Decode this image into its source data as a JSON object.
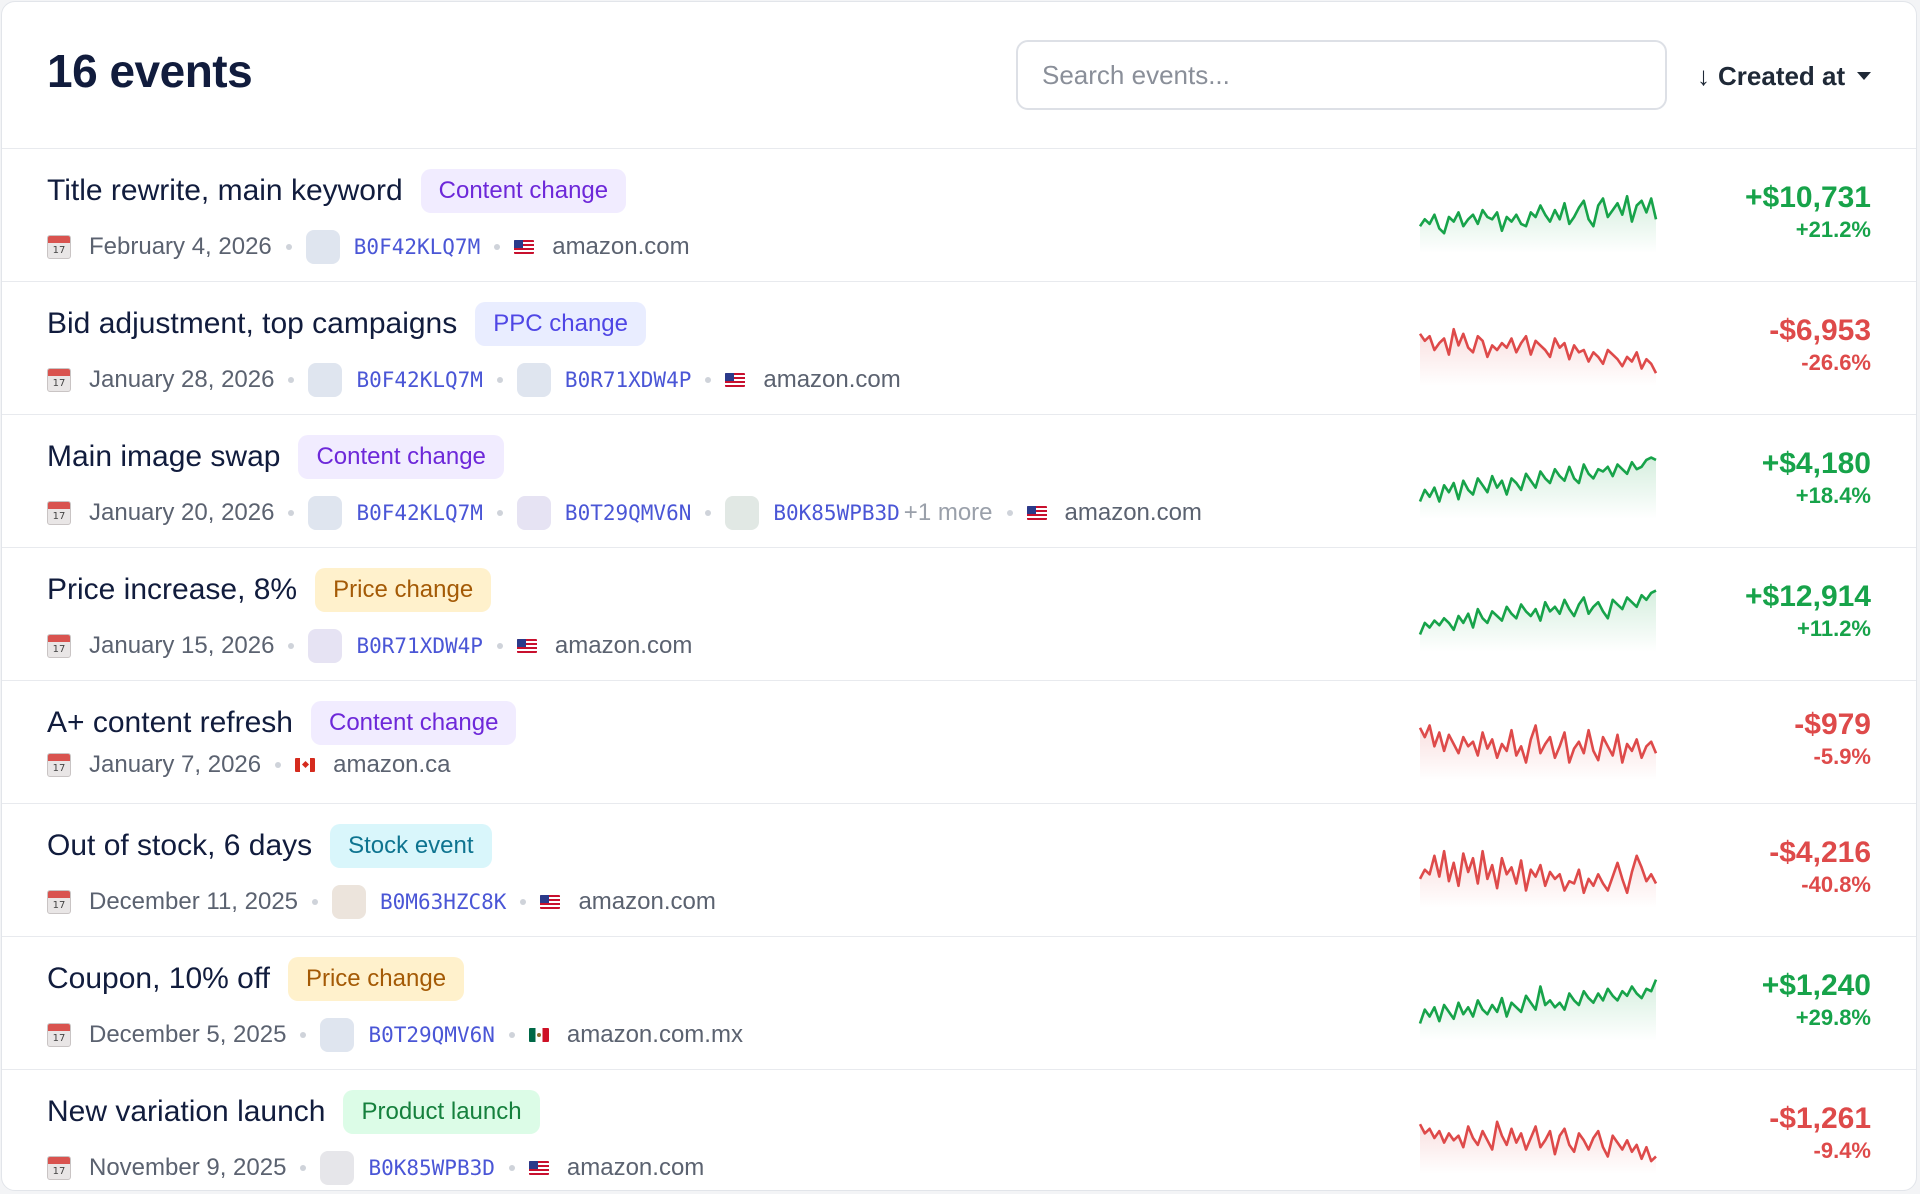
{
  "header": {
    "title": "16 events",
    "search_placeholder": "Search events...",
    "sort_label": "Created at",
    "sort_arrow": "↓"
  },
  "colors": {
    "positive": "#17a34a",
    "negative": "#de4a4a",
    "asin": "#4a56d6"
  },
  "events": [
    {
      "name": "Title rewrite, main keyword",
      "tag": "Content change",
      "tag_type": "content",
      "date": "February 4, 2026",
      "asins": [
        {
          "code": "B0F42KLQ7M",
          "thumb": "#dfe5ef"
        }
      ],
      "more": "",
      "flag": "us",
      "marketplace": "amazon.com",
      "amount": "+$10,731",
      "percent": "+21.2%",
      "trend": "positive",
      "spark": [
        38,
        44,
        40,
        48,
        36,
        32,
        46,
        42,
        50,
        38,
        44,
        48,
        40,
        52,
        46,
        44,
        50,
        34,
        46,
        42,
        48,
        40,
        38,
        50,
        46,
        56,
        48,
        42,
        52,
        44,
        58,
        40,
        46,
        54,
        60,
        44,
        38,
        56,
        62,
        46,
        52,
        58,
        48,
        64,
        42,
        56,
        60,
        50,
        62,
        44
      ]
    },
    {
      "name": "Bid adjustment, top campaigns",
      "tag": "PPC change",
      "tag_type": "ppc",
      "date": "January 28, 2026",
      "asins": [
        {
          "code": "B0F42KLQ7M",
          "thumb": "#dfe5ef"
        },
        {
          "code": "B0R71XDW4P",
          "thumb": "#dfe5ef"
        }
      ],
      "more": "",
      "flag": "us",
      "marketplace": "amazon.com",
      "amount": "-$6,953",
      "percent": "-26.6%",
      "trend": "negative",
      "spark": [
        60,
        54,
        58,
        46,
        52,
        56,
        42,
        64,
        50,
        60,
        48,
        44,
        58,
        54,
        40,
        50,
        46,
        52,
        48,
        56,
        44,
        52,
        58,
        42,
        54,
        50,
        46,
        40,
        56,
        48,
        52,
        38,
        50,
        44,
        46,
        36,
        44,
        40,
        34,
        46,
        42,
        38,
        32,
        40,
        36,
        44,
        30,
        38,
        34,
        26
      ]
    },
    {
      "name": "Main image swap",
      "tag": "Content change",
      "tag_type": "content",
      "date": "January 20, 2026",
      "asins": [
        {
          "code": "B0F42KLQ7M",
          "thumb": "#dfe5ef"
        },
        {
          "code": "B0T29QMV6N",
          "thumb": "#e6e3f3"
        },
        {
          "code": "B0K85WPB3D",
          "thumb": "#e1e8e4"
        }
      ],
      "more": "+1 more",
      "flag": "us",
      "marketplace": "amazon.com",
      "amount": "+$4,180",
      "percent": "+18.4%",
      "trend": "positive",
      "spark": [
        30,
        40,
        34,
        42,
        30,
        44,
        38,
        46,
        32,
        48,
        40,
        36,
        50,
        44,
        38,
        52,
        42,
        48,
        36,
        50,
        46,
        40,
        54,
        48,
        42,
        56,
        50,
        46,
        58,
        52,
        48,
        60,
        50,
        46,
        62,
        54,
        50,
        58,
        56,
        60,
        52,
        62,
        58,
        54,
        64,
        58,
        60,
        66,
        68,
        66
      ]
    },
    {
      "name": "Price increase, 8%",
      "tag": "Price change",
      "tag_type": "price",
      "date": "January 15, 2026",
      "asins": [
        {
          "code": "B0R71XDW4P",
          "thumb": "#e6e3f3"
        }
      ],
      "more": "",
      "flag": "us",
      "marketplace": "amazon.com",
      "amount": "+$12,914",
      "percent": "+11.2%",
      "trend": "positive",
      "spark": [
        30,
        40,
        36,
        42,
        38,
        44,
        40,
        34,
        46,
        40,
        48,
        36,
        52,
        44,
        40,
        50,
        46,
        42,
        54,
        48,
        44,
        56,
        50,
        46,
        52,
        42,
        58,
        50,
        54,
        48,
        60,
        52,
        46,
        56,
        62,
        48,
        54,
        58,
        50,
        44,
        60,
        56,
        52,
        62,
        58,
        54,
        64,
        60,
        66,
        68
      ]
    },
    {
      "name": "A+ content refresh",
      "tag": "Content change",
      "tag_type": "content",
      "date": "January 7, 2026",
      "asins": [],
      "more": "",
      "flag": "ca",
      "marketplace": "amazon.ca",
      "amount": "-$979",
      "percent": "-5.9%",
      "trend": "negative",
      "spark": [
        60,
        52,
        62,
        44,
        56,
        40,
        54,
        46,
        38,
        52,
        44,
        48,
        36,
        56,
        42,
        50,
        34,
        46,
        40,
        58,
        36,
        44,
        30,
        50,
        62,
        38,
        46,
        52,
        34,
        44,
        56,
        30,
        42,
        48,
        38,
        58,
        40,
        32,
        52,
        44,
        36,
        54,
        30,
        46,
        40,
        50,
        34,
        44,
        48,
        38
      ]
    },
    {
      "name": "Out of stock, 6 days",
      "tag": "Stock event",
      "tag_type": "stock",
      "date": "December 11, 2025",
      "asins": [
        {
          "code": "B0M63HZC8K",
          "thumb": "#ece4dc"
        }
      ],
      "more": "",
      "flag": "us",
      "marketplace": "amazon.com",
      "amount": "-$4,216",
      "percent": "-40.8%",
      "trend": "negative",
      "spark": [
        40,
        48,
        44,
        60,
        42,
        64,
        38,
        54,
        34,
        62,
        46,
        58,
        36,
        64,
        40,
        52,
        32,
        58,
        44,
        50,
        36,
        56,
        30,
        48,
        42,
        52,
        34,
        46,
        40,
        44,
        30,
        38,
        36,
        48,
        28,
        40,
        34,
        44,
        36,
        30,
        42,
        54,
        40,
        28,
        46,
        60,
        50,
        38,
        44,
        36
      ]
    },
    {
      "name": "Coupon, 10% off",
      "tag": "Price change",
      "tag_type": "price",
      "date": "December 5, 2025",
      "asins": [
        {
          "code": "B0T29QMV6N",
          "thumb": "#dfe5ef"
        }
      ],
      "more": "",
      "flag": "mx",
      "marketplace": "amazon.com.mx",
      "amount": "+$1,240",
      "percent": "+29.8%",
      "trend": "positive",
      "spark": [
        30,
        42,
        36,
        44,
        32,
        46,
        40,
        34,
        48,
        38,
        44,
        36,
        50,
        42,
        38,
        46,
        40,
        52,
        36,
        48,
        44,
        40,
        54,
        48,
        42,
        62,
        46,
        50,
        44,
        48,
        42,
        56,
        50,
        46,
        58,
        52,
        48,
        56,
        50,
        60,
        54,
        50,
        58,
        54,
        62,
        56,
        52,
        60,
        58,
        68
      ]
    },
    {
      "name": "New variation launch",
      "tag": "Product launch",
      "tag_type": "launch",
      "date": "November 9, 2025",
      "asins": [
        {
          "code": "B0K85WPB3D",
          "thumb": "#e6e6ea"
        }
      ],
      "more": "",
      "flag": "us",
      "marketplace": "amazon.com",
      "amount": "-$1,261",
      "percent": "-9.4%",
      "trend": "negative",
      "spark": [
        58,
        50,
        54,
        46,
        52,
        42,
        50,
        44,
        48,
        38,
        56,
        46,
        40,
        52,
        44,
        36,
        60,
        48,
        40,
        54,
        42,
        50,
        36,
        46,
        56,
        38,
        44,
        52,
        32,
        48,
        54,
        40,
        34,
        50,
        44,
        36,
        46,
        52,
        38,
        30,
        48,
        42,
        36,
        44,
        34,
        40,
        28,
        38,
        26,
        30
      ]
    }
  ]
}
